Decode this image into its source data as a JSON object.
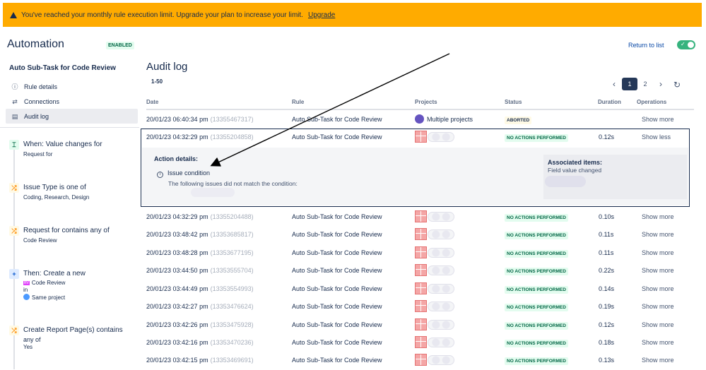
{
  "banner": {
    "message": "You've reached your monthly rule execution limit. Upgrade your plan to increase your limit.",
    "upgrade_link": "Upgrade"
  },
  "header": {
    "title": "Automation",
    "badge": "ENABLED",
    "return_link": "Return to list",
    "toggle_check": "✓"
  },
  "sidebar": {
    "rule_name": "Auto Sub-Task for Code Review",
    "items": [
      {
        "label": "Rule details",
        "icon": "ⓘ"
      },
      {
        "label": "Connections",
        "icon": "⇄"
      },
      {
        "label": "Audit log",
        "icon": "▤"
      }
    ],
    "steps": [
      {
        "icon": "⌶",
        "title": "When: Value changes for",
        "sub": "Request for"
      },
      {
        "icon": "⤮",
        "title": "Issue Type is one of",
        "sub": "Coding, Research, Design"
      },
      {
        "icon": "⤮",
        "title": "Request for contains any of",
        "sub": "Code Review"
      },
      {
        "icon": "+",
        "title": "Then: Create a new",
        "sub1": "Code Review",
        "sub2": "in",
        "sub3": "Same project",
        "subicon": "RV"
      },
      {
        "icon": "⤮",
        "title": "Create Report Page(s) contains",
        "sub1": "any of",
        "sub2": "Yes"
      }
    ]
  },
  "main": {
    "title": "Audit log",
    "range": "1-50",
    "pages": [
      "‹",
      "1",
      "2",
      "›"
    ],
    "refresh_icon": "↻",
    "columns": [
      "Date",
      "Rule",
      "Projects",
      "Status",
      "Duration",
      "Operations"
    ],
    "rows": [
      {
        "date": "20/01/23 06:40:34 pm",
        "id": "(13355467317)",
        "rule": "Auto Sub-Task for Code Review",
        "project": "Multiple projects",
        "status": "ABORTED",
        "duration": "",
        "ops": "Show more"
      },
      {
        "date": "20/01/23 04:32:29 pm",
        "id": "(13355204858)",
        "rule": "Auto Sub-Task for Code Review",
        "project": "",
        "status": "NO ACTIONS PERFORMED",
        "duration": "0.12s",
        "ops": "Show less"
      },
      {
        "date": "20/01/23 04:32:29 pm",
        "id": "(13355204488)",
        "rule": "Auto Sub-Task for Code Review",
        "project": "",
        "status": "NO ACTIONS PERFORMED",
        "duration": "0.10s",
        "ops": "Show more"
      },
      {
        "date": "20/01/23 03:48:42 pm",
        "id": "(13353685817)",
        "rule": "Auto Sub-Task for Code Review",
        "project": "",
        "status": "NO ACTIONS PERFORMED",
        "duration": "0.11s",
        "ops": "Show more"
      },
      {
        "date": "20/01/23 03:48:28 pm",
        "id": "(13353677195)",
        "rule": "Auto Sub-Task for Code Review",
        "project": "",
        "status": "NO ACTIONS PERFORMED",
        "duration": "0.11s",
        "ops": "Show more"
      },
      {
        "date": "20/01/23 03:44:50 pm",
        "id": "(13353555704)",
        "rule": "Auto Sub-Task for Code Review",
        "project": "",
        "status": "NO ACTIONS PERFORMED",
        "duration": "0.22s",
        "ops": "Show more"
      },
      {
        "date": "20/01/23 03:44:49 pm",
        "id": "(13353554993)",
        "rule": "Auto Sub-Task for Code Review",
        "project": "",
        "status": "NO ACTIONS PERFORMED",
        "duration": "0.14s",
        "ops": "Show more"
      },
      {
        "date": "20/01/23 03:42:27 pm",
        "id": "(13353476624)",
        "rule": "Auto Sub-Task for Code Review",
        "project": "",
        "status": "NO ACTIONS PERFORMED",
        "duration": "0.19s",
        "ops": "Show more"
      },
      {
        "date": "20/01/23 03:42:26 pm",
        "id": "(13353475928)",
        "rule": "Auto Sub-Task for Code Review",
        "project": "",
        "status": "NO ACTIONS PERFORMED",
        "duration": "0.12s",
        "ops": "Show more"
      },
      {
        "date": "20/01/23 03:42:16 pm",
        "id": "(13353470236)",
        "rule": "Auto Sub-Task for Code Review",
        "project": "",
        "status": "NO ACTIONS PERFORMED",
        "duration": "0.18s",
        "ops": "Show more"
      },
      {
        "date": "20/01/23 03:42:15 pm",
        "id": "(13353469691)",
        "rule": "Auto Sub-Task for Code Review",
        "project": "",
        "status": "NO ACTIONS PERFORMED",
        "duration": "0.13s",
        "ops": "Show more"
      }
    ],
    "details": {
      "title": "Action details:",
      "condition": "Issue condition",
      "condition_desc": "The following issues did not match the condition:",
      "associated_title": "Associated items:",
      "associated_sub": "Field value changed"
    }
  },
  "colors": {
    "banner": "#ffab00",
    "status_green_bg": "#e3fcef",
    "status_green_text": "#006644",
    "annotation": "#000000"
  }
}
